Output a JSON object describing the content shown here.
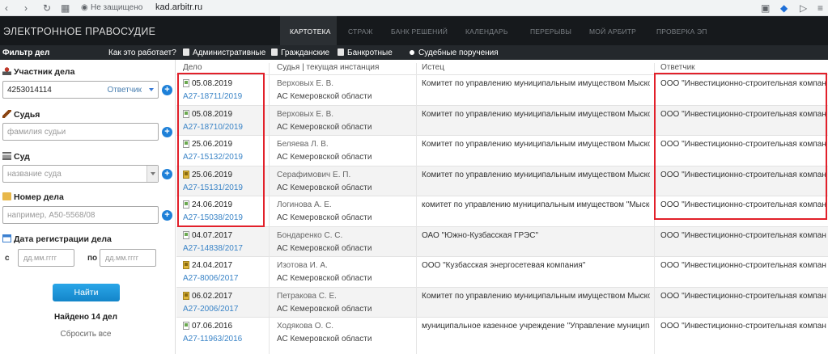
{
  "browser": {
    "security": "Не защищено",
    "url": "kad.arbitr.ru"
  },
  "nav": {
    "brand": "ЭЛЕКТРОННОЕ ПРАВОСУДИЕ",
    "items": [
      "КАРТОТЕКА",
      "СТРАЖ",
      "БАНК РЕШЕНИЙ",
      "КАЛЕНДАРЬ",
      "ПЕРЕРЫВЫ",
      "МОЙ АРБИТР",
      "ПРОВЕРКА ЭП"
    ]
  },
  "subbar": {
    "filter": "Фильтр дел",
    "how": "Как это работает?",
    "types": [
      "Административные",
      "Гражданские",
      "Банкротные",
      "Судебные поручения"
    ]
  },
  "sidebar": {
    "participant_label": "Участник дела",
    "participant_value": "4253014114",
    "participant_role": "Ответчик",
    "judge_label": "Судья",
    "judge_placeholder": "фамилия судьи",
    "court_label": "Суд",
    "court_placeholder": "название суда",
    "case_label": "Номер дела",
    "case_placeholder": "например, А50-5568/08",
    "date_label": "Дата регистрации дела",
    "from": "с",
    "to": "по",
    "date_placeholder": "дд.мм.гггг",
    "find": "Найти",
    "found": "Найдено 14 дел",
    "reset": "Сбросить все"
  },
  "table": {
    "headers": [
      "Дело",
      "Судья | текущая инстанция",
      "Истец",
      "Ответчик"
    ],
    "rows": [
      {
        "date": "05.08.2019",
        "num": "А27-18711/2019",
        "judge": "Верховых Е. В.",
        "court": "АС Кемеровской области",
        "plaintiff": "Комитет по управлению муниципальным имуществом Мысковского",
        "defendant": "ООО \"Инвестиционно-строительная компания\""
      },
      {
        "date": "05.08.2019",
        "num": "А27-18710/2019",
        "judge": "Верховых Е. В.",
        "court": "АС Кемеровской области",
        "plaintiff": "Комитет по управлению муниципальным имуществом Мысковского",
        "defendant": "ООО \"Инвестиционно-строительная компания\""
      },
      {
        "date": "25.06.2019",
        "num": "А27-15132/2019",
        "judge": "Беляева Л. В.",
        "court": "АС Кемеровской области",
        "plaintiff": "Комитет по управлению муниципальным имуществом Мысковского",
        "defendant": "ООО \"Инвестиционно-строительная компания\""
      },
      {
        "date": "25.06.2019",
        "num": "А27-15131/2019",
        "judge": "Серафимович Е. П.",
        "court": "АС Кемеровской области",
        "plaintiff": "Комитет по управлению муниципальным имуществом Мысковского",
        "defendant": "ООО \"Инвестиционно-строительная компания\""
      },
      {
        "date": "24.06.2019",
        "num": "А27-15038/2019",
        "judge": "Логинова А. Е.",
        "court": "АС Кемеровской области",
        "plaintiff": "комитет по управлению муниципальным имуществом \"Мысковского",
        "defendant": "ООО \"Инвестиционно-строительная компания\""
      },
      {
        "date": "04.07.2017",
        "num": "А27-14838/2017",
        "judge": "Бондаренко С. С.",
        "court": "АС Кемеровской области",
        "plaintiff": "ОАО \"Южно-Кузбасская ГРЭС\"",
        "defendant": "ООО \"Инвестиционно-строительная компания\""
      },
      {
        "date": "24.04.2017",
        "num": "А27-8006/2017",
        "judge": "Изотова И. А.",
        "court": "АС Кемеровской области",
        "plaintiff": "ООО \"Кузбасская энергосетевая компания\"",
        "defendant": "ООО \"Инвестиционно-строительная компания\""
      },
      {
        "date": "06.02.2017",
        "num": "А27-2006/2017",
        "judge": "Петракова С. Е.",
        "court": "АС Кемеровской области",
        "plaintiff": "Комитет по управлению муниципальным имуществом Мысковского",
        "defendant": "ООО \"Инвестиционно-строительная компания\""
      },
      {
        "date": "07.06.2016",
        "num": "А27-11963/2016",
        "judge": "Ходякова О. С.",
        "court": "АС Кемеровской области",
        "plaintiff": "муниципальное казенное учреждение \"Управление муниципальны",
        "defendant": "ООО \"Инвестиционно-строительная компания\""
      }
    ]
  },
  "colors": {
    "nav_bg": "#16191c",
    "highlight": "#e2202a",
    "link": "#3a84c7",
    "button": "#1e80d8"
  }
}
